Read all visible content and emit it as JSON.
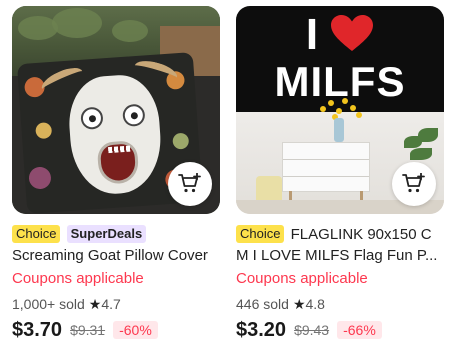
{
  "products": [
    {
      "badges": [
        "Choice",
        "SuperDeals"
      ],
      "title": "Screaming Goat Pillow Cover Soft Prote...",
      "coupon": "Coupons applicable",
      "sold": "1,000+ sold",
      "rating": "4.7",
      "price": "$3.70",
      "old_price": "$9.31",
      "discount": "-60%",
      "image_icon": "goat-pillow-photo"
    },
    {
      "badges": [
        "Choice"
      ],
      "title": "FLAGLINK 90x150 C M I LOVE MILFS Flag Fun P...",
      "coupon": "Coupons applicable",
      "sold": "446 sold",
      "rating": "4.8",
      "price": "$3.20",
      "old_price": "$9.43",
      "discount": "-66%",
      "image_icon": "flag-photo",
      "flag_text": {
        "line1": "I",
        "line2": "MILFS"
      }
    }
  ],
  "icons": {
    "cart": "add-to-cart-icon",
    "star": "star-icon",
    "heart": "heart-icon"
  },
  "colors": {
    "accent": "#fd384f",
    "choice_badge": "#fde14b",
    "superdeals_badge": "#eae0ff"
  }
}
